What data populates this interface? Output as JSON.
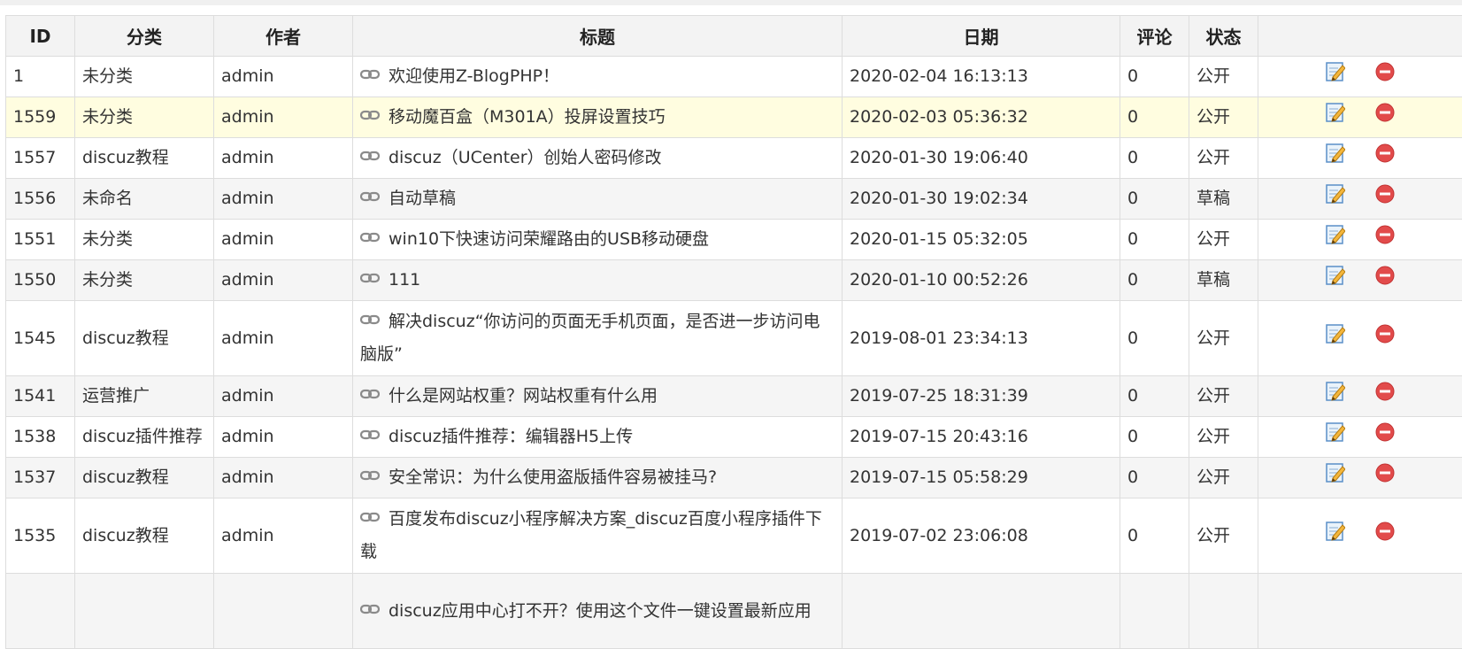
{
  "columns": [
    {
      "key": "id",
      "label": "ID"
    },
    {
      "key": "category",
      "label": "分类"
    },
    {
      "key": "author",
      "label": "作者"
    },
    {
      "key": "title",
      "label": "标题"
    },
    {
      "key": "date",
      "label": "日期"
    },
    {
      "key": "comments",
      "label": "评论"
    },
    {
      "key": "status",
      "label": "状态"
    },
    {
      "key": "actions",
      "label": ""
    }
  ],
  "rows": [
    {
      "id": "1",
      "category": "未分类",
      "author": "admin",
      "title": "欢迎使用Z-BlogPHP！",
      "date": "2020-02-04 16:13:13",
      "comments": "0",
      "status": "公开"
    },
    {
      "id": "1559",
      "category": "未分类",
      "author": "admin",
      "title": "移动魔百盒（M301A）投屏设置技巧",
      "date": "2020-02-03 05:36:32",
      "comments": "0",
      "status": "公开"
    },
    {
      "id": "1557",
      "category": "discuz教程",
      "author": "admin",
      "title": "discuz（UCenter）创始人密码修改",
      "date": "2020-01-30 19:06:40",
      "comments": "0",
      "status": "公开"
    },
    {
      "id": "1556",
      "category": "未命名",
      "author": "admin",
      "title": "自动草稿",
      "date": "2020-01-30 19:02:34",
      "comments": "0",
      "status": "草稿"
    },
    {
      "id": "1551",
      "category": "未分类",
      "author": "admin",
      "title": "win10下快速访问荣耀路由的USB移动硬盘",
      "date": "2020-01-15 05:32:05",
      "comments": "0",
      "status": "公开"
    },
    {
      "id": "1550",
      "category": "未分类",
      "author": "admin",
      "title": "111",
      "date": "2020-01-10 00:52:26",
      "comments": "0",
      "status": "草稿"
    },
    {
      "id": "1545",
      "category": "discuz教程",
      "author": "admin",
      "title": "解决discuz“你访问的页面无手机页面，是否进一步访问电脑版”",
      "date": "2019-08-01 23:34:13",
      "comments": "0",
      "status": "公开"
    },
    {
      "id": "1541",
      "category": "运营推广",
      "author": "admin",
      "title": "什么是网站权重？网站权重有什么用",
      "date": "2019-07-25 18:31:39",
      "comments": "0",
      "status": "公开"
    },
    {
      "id": "1538",
      "category": "discuz插件推荐",
      "author": "admin",
      "title": "discuz插件推荐：编辑器H5上传",
      "date": "2019-07-15 20:43:16",
      "comments": "0",
      "status": "公开"
    },
    {
      "id": "1537",
      "category": "discuz教程",
      "author": "admin",
      "title": "安全常识：为什么使用盗版插件容易被挂马?",
      "date": "2019-07-15 05:58:29",
      "comments": "0",
      "status": "公开"
    },
    {
      "id": "1535",
      "category": "discuz教程",
      "author": "admin",
      "title": "百度发布discuz小程序解决方案_discuz百度小程序插件下载",
      "date": "2019-07-02 23:06:08",
      "comments": "0",
      "status": "公开"
    },
    {
      "id": "",
      "category": "",
      "author": "",
      "title": "discuz应用中心打不开？使用这个文件一键设置最新应用",
      "date": "",
      "comments": "",
      "status": ""
    }
  ],
  "icons": {
    "title_prefix": "link-icon",
    "edit": "edit-icon",
    "delete": "delete-icon"
  },
  "colors": {
    "header_bg": "#f3f3f3",
    "row_alt_bg": "#f5f5f5",
    "row_highlight_bg": "#fffde0",
    "border": "#dddddd",
    "delete_red": "#e24b4b"
  }
}
